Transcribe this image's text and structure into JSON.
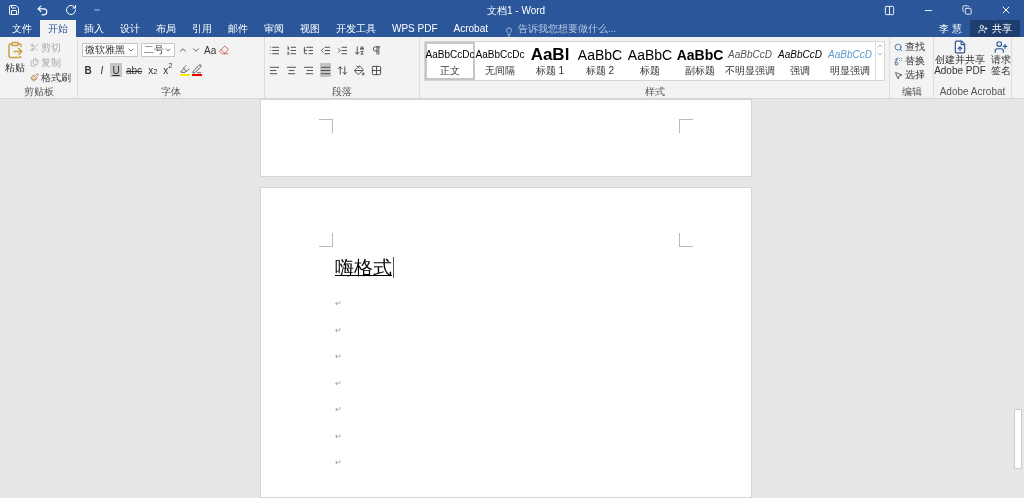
{
  "title_bar": {
    "title": "文档1 - Word"
  },
  "tabs": [
    {
      "label": "文件",
      "selected": false
    },
    {
      "label": "开始",
      "selected": true
    },
    {
      "label": "插入",
      "selected": false
    },
    {
      "label": "设计",
      "selected": false
    },
    {
      "label": "布局",
      "selected": false
    },
    {
      "label": "引用",
      "selected": false
    },
    {
      "label": "邮件",
      "selected": false
    },
    {
      "label": "审阅",
      "selected": false
    },
    {
      "label": "视图",
      "selected": false
    },
    {
      "label": "开发工具",
      "selected": false
    },
    {
      "label": "WPS PDF",
      "selected": false
    },
    {
      "label": "Acrobat",
      "selected": false
    }
  ],
  "tell_me": {
    "placeholder": "告诉我您想要做什么..."
  },
  "user": "李 慧",
  "share": "共享",
  "clipboard": {
    "paste": "粘贴",
    "items": [
      {
        "label": "剪切",
        "disabled": true
      },
      {
        "label": "复制",
        "disabled": true
      },
      {
        "label": "格式刷",
        "disabled": false
      }
    ],
    "label": "剪贴板"
  },
  "font": {
    "font_name": "微软雅黑",
    "font_size": "二号",
    "case_button": "Aa",
    "format_buttons": [
      {
        "label": "B",
        "selected": false
      },
      {
        "label": "I",
        "selected": false
      },
      {
        "label": "U",
        "selected": true
      },
      {
        "label": "abc",
        "selected": false
      },
      {
        "label": "x$_{2}$",
        "selected": false
      },
      {
        "label": "x$^{2}$",
        "selected": false
      }
    ],
    "label": "字体"
  },
  "paragraph": {
    "label": "段落"
  },
  "styles": {
    "label": "样式",
    "items": [
      {
        "preview": "AaBbCcDc",
        "name": "正文",
        "kind": "normal",
        "selected": true
      },
      {
        "preview": "AaBbCcDc",
        "name": "无间隔",
        "kind": "normal",
        "selected": false
      },
      {
        "preview": "AaBl",
        "name": "标题 1",
        "kind": "heading1",
        "selected": false
      },
      {
        "preview": "AaBbC",
        "name": "标题 2",
        "kind": "heading2",
        "selected": false
      },
      {
        "preview": "AaBbC",
        "name": "标题",
        "kind": "title",
        "selected": false
      },
      {
        "preview": "AaBbC",
        "name": "副标题",
        "kind": "bold",
        "selected": false
      },
      {
        "preview": "AaBbCcD",
        "name": "不明显强调",
        "kind": "subtle",
        "selected": false
      },
      {
        "preview": "AaBbCcD",
        "name": "强调",
        "kind": "emphasis",
        "selected": false
      },
      {
        "preview": "AaBbCcD",
        "name": "明显强调",
        "kind": "intense",
        "selected": false
      }
    ]
  },
  "editing": {
    "label": "编辑",
    "items": [
      "查找",
      "替换",
      "选择"
    ]
  },
  "acrobat": {
    "label": "Adobe Acrobat",
    "items": [
      "创建并共享 Adobe PDF",
      "请求签名"
    ]
  },
  "document": {
    "heading": "嗨格式",
    "paragraph_marks": [
      "↵",
      "↵",
      "↵",
      "↵",
      "↵",
      "↵",
      "↵"
    ]
  }
}
